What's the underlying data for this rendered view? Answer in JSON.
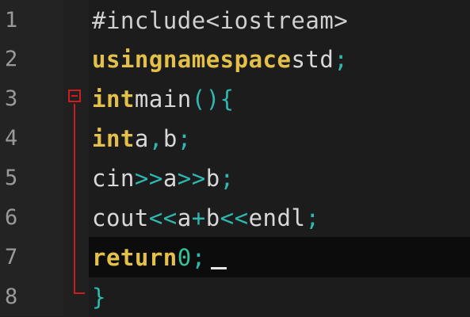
{
  "editor": {
    "lines": [
      {
        "number": "1",
        "text": "#include<iostream>"
      },
      {
        "number": "2",
        "kw1": "using",
        "kw2": "namespace",
        "id": "std",
        "op": ";"
      },
      {
        "number": "3",
        "kw": "int",
        "id": "main",
        "op": "(){"
      },
      {
        "number": "4",
        "kw": "int",
        "id1": "a",
        "op1": ",",
        "id2": "b",
        "op2": ";"
      },
      {
        "number": "5",
        "id1": "cin",
        "op1": ">>",
        "id2": "a",
        "op2": ">>",
        "id3": "b",
        "op3": ";"
      },
      {
        "number": "6",
        "id1": "cout",
        "op1": "<<",
        "id2": "a",
        "op2": "+",
        "id3": "b",
        "op3": "<<",
        "id4": "endl",
        "op4": ";"
      },
      {
        "number": "7",
        "kw": "return",
        "num": "0",
        "op": ";"
      },
      {
        "number": "8",
        "op": "}"
      }
    ],
    "current_line": 7,
    "colors": {
      "background": "#1c1c1c",
      "keyword": "#e2c04a",
      "operator": "#2eb8b0",
      "number": "#37c29a",
      "fold_marker": "#cc1e1e"
    },
    "fold_icon": "fold-collapse-minus-icon"
  }
}
